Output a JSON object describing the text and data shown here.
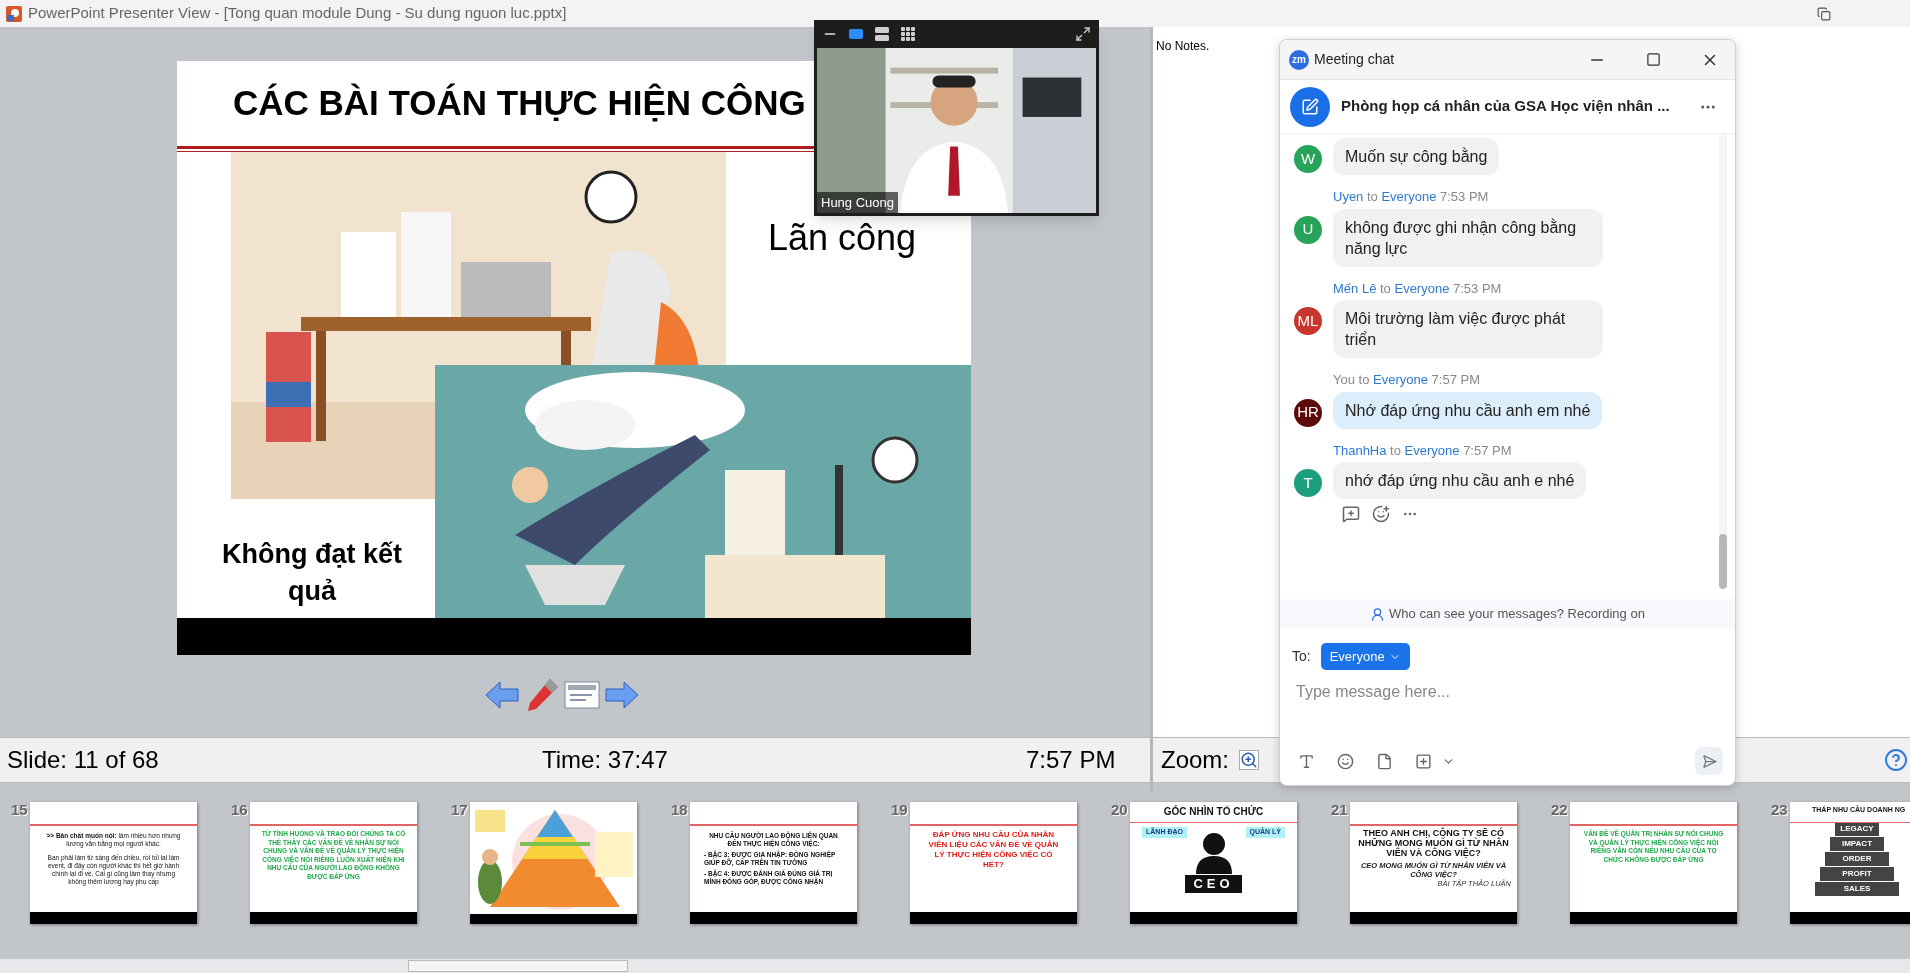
{
  "window": {
    "title": "PowerPoint Presenter View - [Tong quan module Dung - Su dung nguon luc.pptx]"
  },
  "slide": {
    "title": "CÁC BÀI TOÁN THỰC HIỆN CÔNG",
    "caption_right": "Lãn công",
    "caption_left": "Không đạt kết quả"
  },
  "status_bar": {
    "slide": "Slide: 11 of 68",
    "time": "Time: 37:47",
    "clock": "7:57 PM"
  },
  "notes": {
    "text": "No Notes.",
    "zoom_label": "Zoom:"
  },
  "video": {
    "name": "Hung Cuong",
    "views": [
      {
        "kind": "speaker",
        "selected": true
      },
      {
        "kind": "stacked",
        "selected": false
      },
      {
        "kind": "gallery",
        "selected": false
      }
    ]
  },
  "chat": {
    "logo": "zm",
    "title": "Meeting chat",
    "room": "Phòng họp cá nhân của GSA Học viện nhân ...",
    "messages": [
      {
        "avatar": "W",
        "color": "#27a35a",
        "text": "Muốn sự công bằng",
        "mine": false
      },
      {
        "avatar": "U",
        "color": "#27a35a",
        "sender": "Uyen",
        "to": "to",
        "recipient": "Everyone",
        "time": "7:53 PM",
        "text": "không được ghi nhận công bằng năng lực",
        "mine": false
      },
      {
        "avatar": "ML",
        "color": "#c8372d",
        "sender": "Mến Lê",
        "to": "to",
        "recipient": "Everyone",
        "time": "7:53 PM",
        "text": "Môi trường làm việc được phát triển",
        "mine": false
      },
      {
        "avatar": "HR",
        "color": "#5c0a0a",
        "sender": "You",
        "to": "to",
        "recipient": "Everyone",
        "time": "7:57 PM",
        "text": "Nhớ đáp ứng nhu cầu anh em nhé",
        "mine": true
      },
      {
        "avatar": "T",
        "color": "#1c9e7c",
        "sender": "ThanhHa",
        "to": "to",
        "recipient": "Everyone",
        "time": "7:57 PM",
        "text": "nhớ đáp ứng nhu cầu anh e nhé",
        "mine": false
      }
    ],
    "privacy": "Who can see your messages? Recording on",
    "to_label": "To:",
    "recipient": "Everyone",
    "placeholder": "Type message here..."
  },
  "thumbnails": [
    {
      "number": "15",
      "kind": "text",
      "paragraphs": [
        "**>> Bản chất muốn nói:** làm nhiều hơn nhưng lương vẫn bằng mọi người khác.",
        "Ban phải làm từ sáng đến chiều, rồi tối lai làm event, đi đây còn người khác thì hết giờ hành chính lại đi về. Cái gì cũng làm thay nhưng không thêm lương hay phụ cấp"
      ]
    },
    {
      "number": "16",
      "kind": "statement",
      "color": "#1faa4a",
      "paragraphs": [
        "TỪ TÌNH HUỐNG VÀ TRAO ĐỔI CHÚNG TA CÓ THỂ THẤY CÁC VẤN ĐỀ VỀ NHÂN SỰ NÓI CHUNG VÀ VẤN ĐỀ VỀ QUẢN LÝ THỰC HIỆN CÔNG VIỆC NÓI RIÊNG LUÔN XUẤT HIỆN KHI NHU CẦU CỦA NGƯỜI LAO ĐỘNG KHÔNG ĐƯỢC ĐÁP ỨNG"
      ]
    },
    {
      "number": "17",
      "kind": "picture"
    },
    {
      "number": "18",
      "kind": "list",
      "heading": "NHU CẦU NGƯỜI LAO ĐỘNG LIÊN QUAN ĐẾN THỰC HIỆN CÔNG VIỆC:",
      "items": [
        "- BẬC 3: ĐƯỢC GIA NHẬP: ĐỒNG NGHIỆP GIÚP ĐỠ, CẤP TRÊN TIN TƯỞNG",
        "- BẬC 4: ĐƯỢC ĐÁNH GIÁ ĐÚNG GIÁ TRỊ MÌNH ĐÓNG GÓP, ĐƯỢC CÔNG NHẬN"
      ]
    },
    {
      "number": "19",
      "kind": "statement",
      "color": "#e0201b",
      "paragraphs": [
        "ĐÁP ỨNG NHU CẦU CỦA NHÂN VIÊN LIỆU CÁC VẤN ĐỀ VỀ QUẢN LÝ THỰC HIỆN CÔNG VIỆC CÓ HẾT?"
      ]
    },
    {
      "number": "20",
      "kind": "org",
      "title": "GÓC NHÌN TỔ CHỨC",
      "left_tag": "LÃNH ĐẠO",
      "right_tag": "QUẢN LÝ",
      "badge": "CEO"
    },
    {
      "number": "21",
      "kind": "question",
      "title": "THEO ANH CHỊ, CÔNG TY SẼ CÓ NHỮNG MONG MUỐN GÌ TỪ NHÂN VIÊN VÀ CÔNG VIỆC?",
      "subtitle": "CEO MONG MUỐN GÌ TỪ NHÂN VIÊN VÀ CÔNG VIỆC?",
      "footnote": "BÀI TẬP THẢO LUẬN"
    },
    {
      "number": "22",
      "kind": "statement",
      "color": "#1faa4a",
      "paragraphs": [
        "VẤN ĐỀ VỀ QUẢN TRỊ NHÂN SỰ NÓI CHUNG VÀ QUẢN LÝ THỰC HIỆN CÔNG VIỆC NÓI RIÊNG VẪN CÒN NẾU NHU CẦU CỦA TỔ CHỨC KHÔNG ĐƯỢC ĐÁP ỨNG"
      ]
    },
    {
      "number": "23",
      "kind": "pyramid",
      "title": "THÁP NHU CẦU DOANH NG",
      "levels": [
        "LEGACY",
        "IMPACT",
        "ORDER",
        "PROFIT",
        "SALES"
      ]
    }
  ]
}
